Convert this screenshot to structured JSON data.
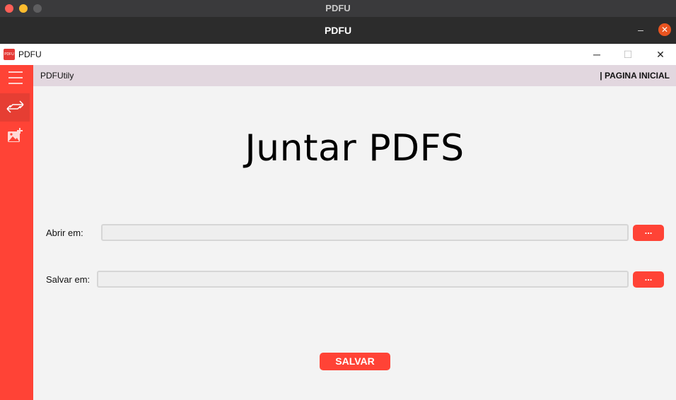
{
  "os_window": {
    "title": "PDFU",
    "traffic_lights": [
      "#ff5f57",
      "#febc2e",
      "#5e5e60"
    ]
  },
  "app_header": {
    "title": "PDFU",
    "minimize_glyph": "–",
    "close_glyph": "✕"
  },
  "window": {
    "title": "PDFU",
    "logo_text": "PDFU",
    "controls": {
      "minimize": "─",
      "maximize": "☐",
      "close": "✕"
    }
  },
  "sidebar": {
    "items": [
      {
        "icon": "hamburger-menu-icon"
      },
      {
        "icon": "swap-arrows-icon",
        "active": true
      },
      {
        "icon": "add-image-icon"
      }
    ]
  },
  "header": {
    "brand": "PDFUtily",
    "breadcrumb": "| PAGINA INICIAL"
  },
  "main": {
    "title": "Juntar PDFS",
    "open_field": {
      "label": "Abrir em:",
      "value": "",
      "button": "..."
    },
    "save_field": {
      "label": "Salvar em:",
      "value": "",
      "button": "..."
    },
    "save_button": "SALVAR"
  },
  "colors": {
    "accent": "#ff4336",
    "sidebar_active": "#e63e33",
    "header_strip": "#e2d7df",
    "background": "#f3f3f3"
  }
}
